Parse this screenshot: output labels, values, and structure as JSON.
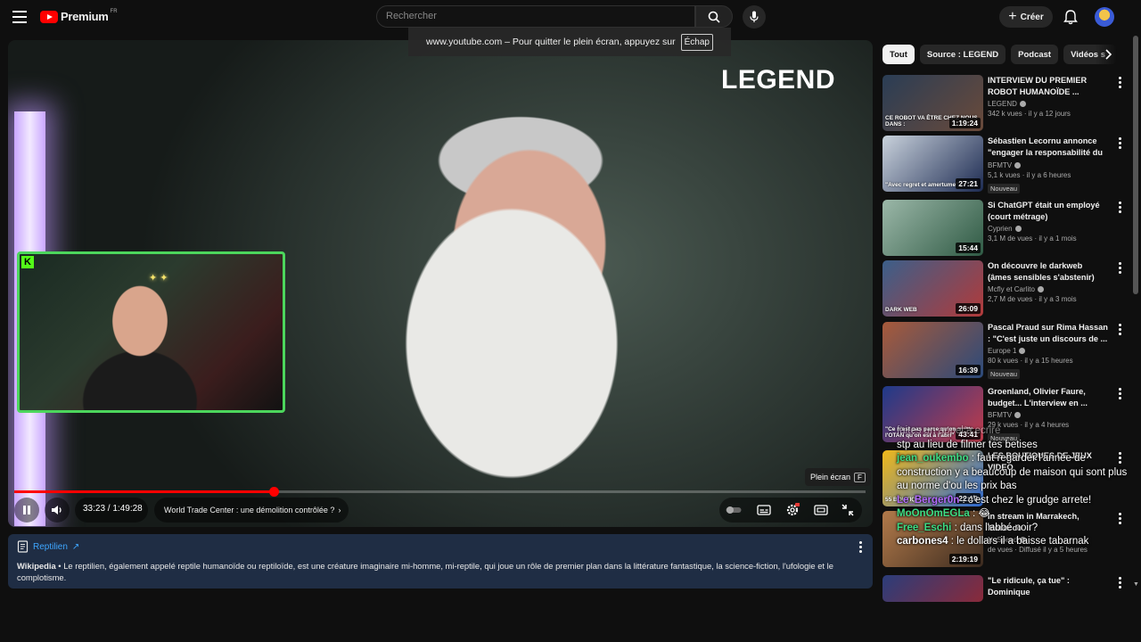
{
  "header": {
    "logo_text": "Premium",
    "region": "FR",
    "search_placeholder": "Rechercher",
    "create_label": "Créer"
  },
  "fullscreen_notice": {
    "text": "www.youtube.com – Pour quitter le plein écran, appuyez sur",
    "key": "Échap"
  },
  "player": {
    "brand_overlay": "LEGEND",
    "current_time": "33:23 / 1:49:28",
    "chapter": "World Trade Center : une démolition contrôlée ?",
    "progress": 0.305,
    "tooltip": "Plein écran",
    "tooltip_key": "F"
  },
  "info_panel": {
    "title": "Reptilien",
    "source": "Wikipedia",
    "text": "Le reptilien, également appelé reptile humanoïde ou reptiloïde, est une créature imaginaire mi-homme, mi-reptile, qui joue un rôle de premier plan dans la littérature fantastique, la science-fiction, l'ufologie et le complotisme."
  },
  "sidebar": {
    "chips": [
      "Tout",
      "Source : LEGEND",
      "Podcast",
      "Vidéos s"
    ],
    "recommendations": [
      {
        "title": "INTERVIEW DU PREMIER ROBOT HUMANOÏDE ...",
        "channel": "LEGEND",
        "meta": "342 k vues · il y a 12 jours",
        "duration": "1:19:24",
        "thumb_caption": "CE ROBOT VA ÊTRE CHEZ NOUS DANS :",
        "badge": "",
        "colors": [
          "#2a3d55",
          "#6a4a3a"
        ]
      },
      {
        "title": "Sébastien Lecornu annonce \"engager la responsabilité du ...",
        "channel": "BFMTV",
        "meta": "5,1 k vues · il y a 6 heures",
        "duration": "27:21",
        "thumb_caption": "\"Avec regret et amertume\"",
        "badge": "Nouveau",
        "colors": [
          "#c9d2dc",
          "#1d2b52"
        ]
      },
      {
        "title": "Si ChatGPT était un employé (court métrage)",
        "channel": "Cyprien",
        "meta": "3,1 M de vues · il y a 1 mois",
        "duration": "15:44",
        "thumb_caption": "",
        "badge": "",
        "colors": [
          "#9bb7a8",
          "#2f5a44"
        ]
      },
      {
        "title": "On découvre le darkweb (âmes sensibles s'abstenir)",
        "channel": "Mcfly et Carlito",
        "meta": "2,7 M de vues · il y a 3 mois",
        "duration": "26:09",
        "thumb_caption": "DARK WEB",
        "badge": "",
        "colors": [
          "#3b5f8a",
          "#b23a3a"
        ]
      },
      {
        "title": "Pascal Praud sur Rima Hassan : \"C'est juste un discours de ...",
        "channel": "Europe 1",
        "meta": "80 k vues · il y a 15 heures",
        "duration": "16:39",
        "thumb_caption": "",
        "badge": "Nouveau",
        "colors": [
          "#a85a3a",
          "#2b4a7a"
        ]
      },
      {
        "title": "Groenland, Olivier Faure, budget... L'interview en ...",
        "channel": "BFMTV",
        "meta": "29 k vues · il y a 4 heures",
        "duration": "43:41",
        "thumb_caption": "\"Ce n'est pas parce qu'on quitte l'OTAN qu'on est à l'abri\"",
        "badge": "Nouveau",
        "colors": [
          "#1e3a8a",
          "#c23b4a"
        ]
      },
      {
        "title": "LES BOUTIQUES DE JEUX VIDEO",
        "channel": "",
        "meta": "",
        "duration": "22:10",
        "thumb_caption": "55 BOUTIQUES",
        "badge": "",
        "colors": [
          "#f0b91a",
          "#2d6ad6"
        ]
      },
      {
        "title": "In stream in Marrakech, Morocco",
        "channel": "NoSpeed",
        "meta": "de vues · Diffusé il y a 5 heures",
        "duration": "2:19:19",
        "thumb_caption": "",
        "badge": "",
        "colors": [
          "#b27a4a",
          "#3a2a1f"
        ]
      },
      {
        "title": "\"Le ridicule, ça tue\" : Dominique",
        "channel": "",
        "meta": "",
        "duration": "",
        "thumb_caption": "",
        "badge": "",
        "colors": [
          "#2b3d7a",
          "#8a2a3a"
        ]
      }
    ]
  },
  "chat": [
    {
      "user": "",
      "text": "faites un appel a ecrire",
      "color": "#ffffff",
      "faded": true
    },
    {
      "user": "",
      "text": "stp au lieu de filmer tes betises",
      "color": "#ffffff",
      "faded": false
    },
    {
      "user": "jean_oukembo",
      "text": ": faut regarder l'année de construction y a beaucoup de maison qui sont plus au norme d'ou les prix bas",
      "color": "#3ddc84",
      "faded": false
    },
    {
      "user": "Le_Berger0n",
      "text": ": c'est chez le grudge arrete!",
      "color": "#b36bff",
      "faded": false
    },
    {
      "user": "MoOnOmEGLa",
      "text": ": 😂",
      "color": "#3ddc84",
      "faded": false
    },
    {
      "user": "Free_Eschi",
      "text": ": dans l'abbé noir?",
      "color": "#3ddc84",
      "faded": false
    },
    {
      "user": "carbones4",
      "text": ": le dollars il a baisse tabarnak",
      "color": "#ffffff",
      "faded": false
    }
  ]
}
